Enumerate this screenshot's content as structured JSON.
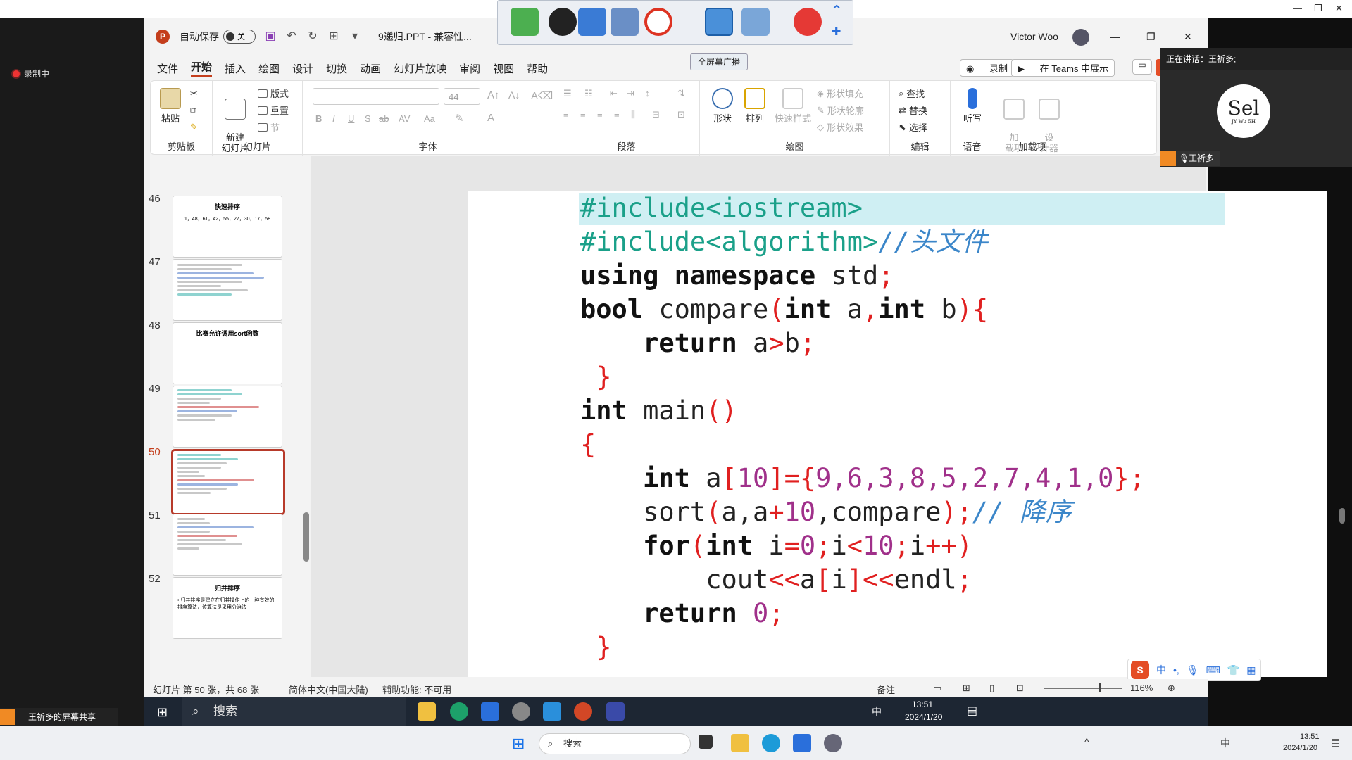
{
  "outer_window": {
    "controls": [
      "—",
      "❐",
      "✕"
    ]
  },
  "recording": {
    "label": "录制中"
  },
  "app": {
    "autosave_label": "自动保存",
    "autosave_state": "关",
    "doc_title": "9递归.PPT - 兼容性...",
    "user_name": "Victor Woo",
    "window_controls": [
      "—",
      "❐",
      "✕"
    ]
  },
  "menu": [
    "文件",
    "开始",
    "插入",
    "绘图",
    "设计",
    "切换",
    "动画",
    "幻灯片放映",
    "审阅",
    "视图",
    "帮助"
  ],
  "menu_right": {
    "record": "录制",
    "teams": "在 Teams 中展示"
  },
  "ribbon": {
    "clipboard": {
      "paste": "粘贴",
      "label": "剪贴板"
    },
    "slides": {
      "new_slide": "新建\n幻灯片",
      "layout": "版式",
      "reset": "重置",
      "section": "节",
      "label": "幻灯片"
    },
    "font": {
      "size": "44",
      "label": "字体",
      "buttons": [
        "B",
        "I",
        "U",
        "S",
        "ab",
        "AV",
        "Aa"
      ]
    },
    "paragraph": {
      "label": "段落"
    },
    "drawing": {
      "shapes": "形状",
      "arrange": "排列",
      "quick_styles": "快速样式",
      "fill": "形状填充",
      "outline": "形状轮廓",
      "effects": "形状效果",
      "label": "绘图"
    },
    "editing": {
      "find": "查找",
      "replace": "替换",
      "select": "选择",
      "label": "编辑"
    },
    "voice": {
      "dictate": "听写",
      "label": "语音"
    },
    "addins": {
      "addins": "加\n载项",
      "designer": "设\n计器",
      "label": "加载项"
    }
  },
  "thumbnails": [
    {
      "num": "46",
      "title": "快速排序",
      "sub": "1，48，61，42，55，27，30，17，58"
    },
    {
      "num": "47",
      "title": "",
      "sub": ""
    },
    {
      "num": "48",
      "title": "比赛允许调用sort函数",
      "sub": ""
    },
    {
      "num": "49",
      "title": "",
      "sub": ""
    },
    {
      "num": "50",
      "title": "",
      "sub": ""
    },
    {
      "num": "51",
      "title": "",
      "sub": ""
    },
    {
      "num": "52",
      "title": "归并排序",
      "sub": "• 归并排序是建立在归并操作上的一种有效的排序算法，该算法是采用分治法"
    }
  ],
  "slide_code": {
    "l1": "#include<iostream>",
    "l2a": "#include<algorithm>",
    "l2b": "//头文件",
    "l3a": "using namespace",
    "l3b": " std",
    "l4a": "bool",
    "l4b": " compare",
    "l4c": "int",
    "l4d": " a",
    "l4e": "int",
    "l4f": " b",
    "l5a": "return",
    "l5b": " a",
    "l5c": "b",
    "l7a": "int",
    "l7b": " main",
    "l9a": "int",
    "l9b": " a",
    "l9c": "10",
    "l9d": "9,6,3,8,5,2,7,4,1,0",
    "l10a": "sort",
    "l10b": "a,a",
    "l10c": "10",
    "l10d": ",compare",
    "l10e": "// 降序",
    "l11a": "for",
    "l11b": "int",
    "l11c": " i",
    "l11d": "0",
    "l11e": "i",
    "l11f": "10",
    "l11g": "i",
    "l12a": "cout",
    "l12b": "a",
    "l12c": "i",
    "l12d": "endl",
    "l13a": "return",
    "l13b": " 0"
  },
  "ime_bar": {
    "lang": "中"
  },
  "status": {
    "slide_info": "幻灯片 第 50 张，共 68 张",
    "language": "简体中文(中国大陆)",
    "accessibility": "辅助功能: 不可用",
    "notes": "备注",
    "zoom": "116%"
  },
  "screenbar": {
    "tooltip": "全屏幕广播"
  },
  "meeting": {
    "speaking": "正在讲话：王祈多;",
    "name": "王祈多",
    "avatar_text": "Sel",
    "avatar_sub": "JY Wu 5H"
  },
  "share_label": "王祈多的屏幕共享",
  "inner_taskbar": {
    "search": "搜索",
    "time": "13:51",
    "date": "2024/1/20",
    "ime": "中"
  },
  "outer_taskbar": {
    "search": "搜索",
    "time": "13:51",
    "date": "2024/1/20",
    "ime": "中"
  }
}
